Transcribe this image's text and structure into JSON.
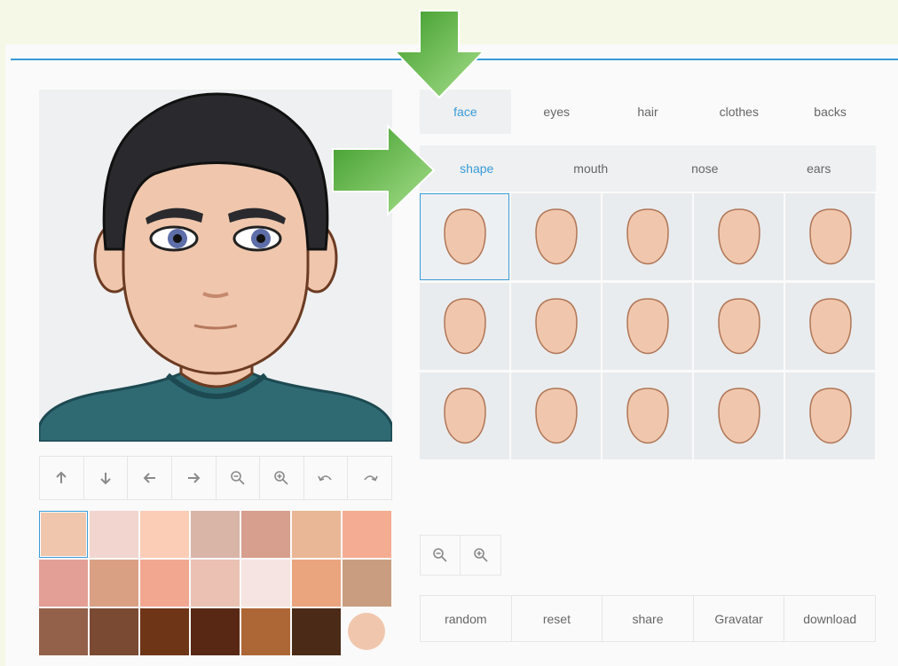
{
  "tabs": [
    {
      "label": "face",
      "active": true
    },
    {
      "label": "eyes",
      "active": false
    },
    {
      "label": "hair",
      "active": false
    },
    {
      "label": "clothes",
      "active": false
    },
    {
      "label": "backs",
      "active": false
    }
  ],
  "subtabs": [
    {
      "label": "shape",
      "active": true
    },
    {
      "label": "mouth",
      "active": false
    },
    {
      "label": "nose",
      "active": false
    },
    {
      "label": "ears",
      "active": false
    }
  ],
  "toolbar_icons": [
    "arrow-up-icon",
    "arrow-down-icon",
    "arrow-left-icon",
    "arrow-right-icon",
    "zoom-out-icon",
    "zoom-in-icon",
    "undo-icon",
    "redo-icon"
  ],
  "skin_swatches": [
    [
      "#f0c7ad",
      "#f2d5cf",
      "#fbcdb7",
      "#d9b5a8",
      "#d79f8d",
      "#e9b795",
      "#f4ad93"
    ],
    [
      "#e39f95",
      "#d9a084",
      "#f2a890",
      "#ebc1b4",
      "#f5e4e1",
      "#eaa47e",
      "#c99e80"
    ],
    [
      "#93614a",
      "#7a4a33",
      "#6e3517",
      "#582814",
      "#ad6635",
      "#4b2b17",
      "#f0c7ad"
    ]
  ],
  "selected_swatch": "#f0c7ad",
  "face_shape_count": 15,
  "accent_color": "#3a9bd8",
  "arrow_color": "#5cb63b",
  "zoom_icons": [
    "zoom-out-icon",
    "zoom-in-icon"
  ],
  "actions": [
    "random",
    "reset",
    "share",
    "Gravatar",
    "download"
  ]
}
